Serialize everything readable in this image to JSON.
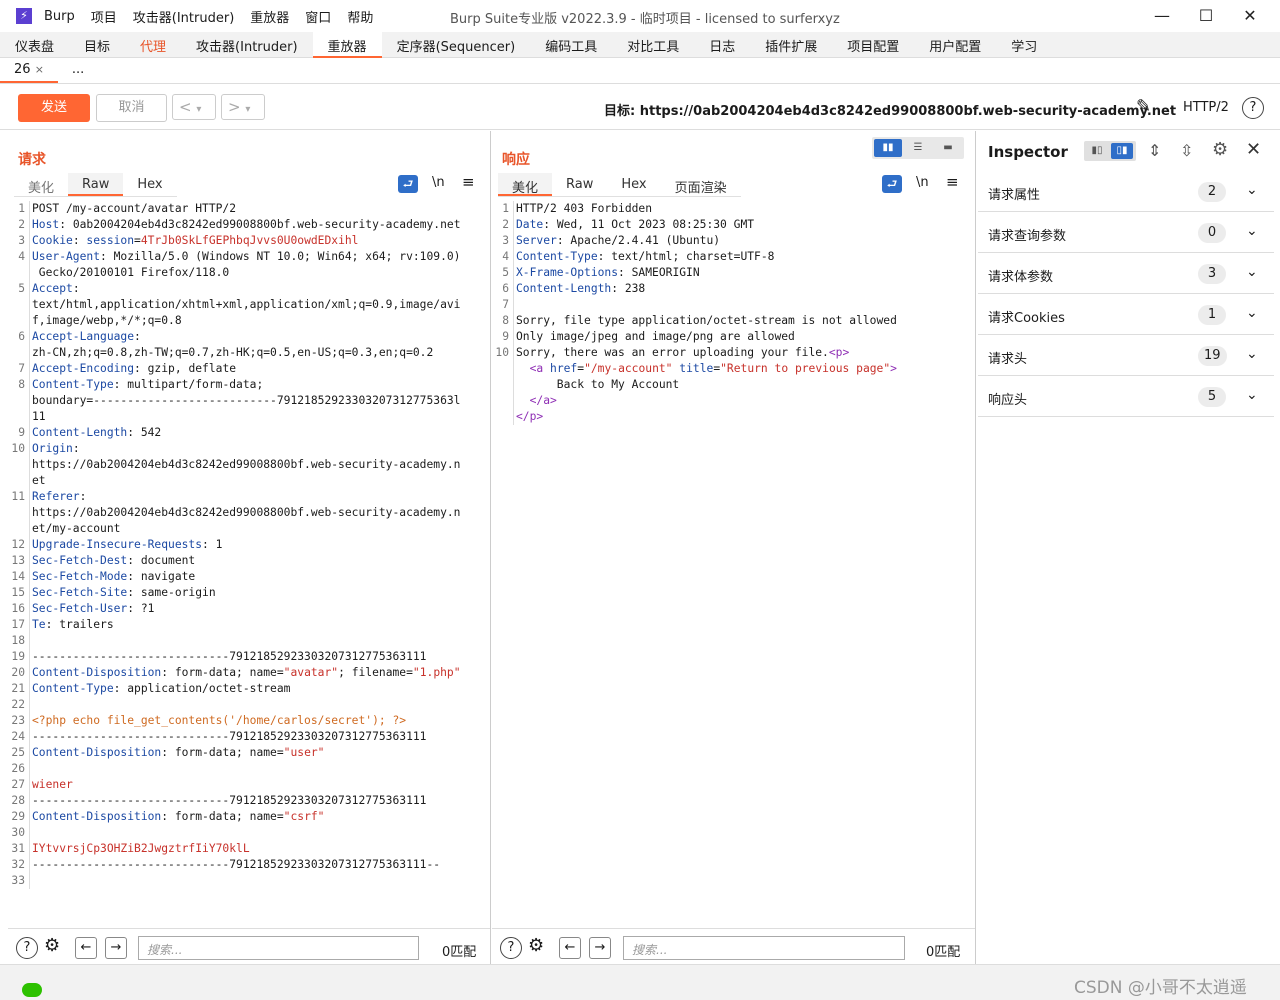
{
  "window": {
    "app_icon": "lightning-icon",
    "menus": [
      "Burp",
      "项目",
      "攻击器(Intruder)",
      "重放器",
      "窗口",
      "帮助"
    ],
    "title": "Burp Suite专业版  v2022.3.9 - 临时项目 - licensed to surferxyz",
    "minimize": "—",
    "maximize": "☐",
    "close": "✕"
  },
  "main_tabs": [
    "仪表盘",
    "目标",
    "代理",
    "攻击器(Intruder)",
    "重放器",
    "定序器(Sequencer)",
    "编码工具",
    "对比工具",
    "日志",
    "插件扩展",
    "项目配置",
    "用户配置",
    "学习"
  ],
  "sub_tabs": {
    "active": "26",
    "close": "×",
    "more": "..."
  },
  "toolbar": {
    "send": "发送",
    "cancel": "取消",
    "back": "<",
    "forward": ">",
    "dropdown": "▾",
    "target_label": "目标: https://0ab2004204eb4d3c8242ed99008800bf.web-security-academy.net",
    "edit_icon": "pencil-icon",
    "http_version": "HTTP/2",
    "help": "?"
  },
  "request": {
    "title": "请求",
    "tabs": [
      "美化",
      "Raw",
      "Hex"
    ],
    "newline": "\\n",
    "menu": "≡",
    "search_placeholder": "搜索...",
    "match_count": "0匹配"
  },
  "response": {
    "title": "响应",
    "tabs": [
      "美化",
      "Raw",
      "Hex",
      "页面渲染"
    ],
    "newline": "\\n",
    "menu": "≡",
    "search_placeholder": "搜索...",
    "match_count": "0匹配"
  },
  "inspector": {
    "title": "Inspector",
    "rows": [
      {
        "label": "请求属性",
        "count": "2"
      },
      {
        "label": "请求查询参数",
        "count": "0"
      },
      {
        "label": "请求体参数",
        "count": "3"
      },
      {
        "label": "请求Cookies",
        "count": "1"
      },
      {
        "label": "请求头",
        "count": "19"
      },
      {
        "label": "响应头",
        "count": "5"
      }
    ]
  },
  "watermark": "CSDN @小哥不太逍遥"
}
